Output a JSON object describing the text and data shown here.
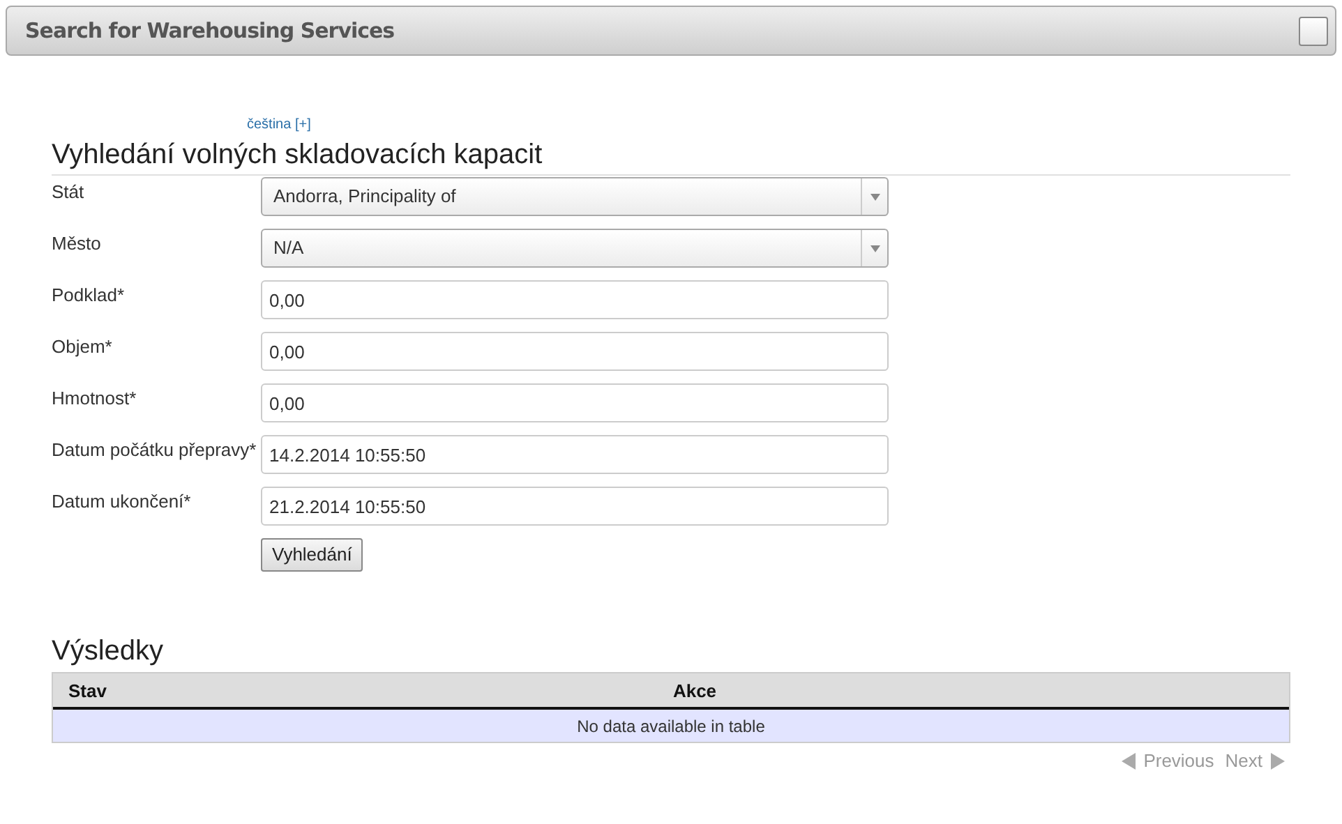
{
  "window": {
    "title": "Search for Warehousing Services",
    "checked": false
  },
  "language_link": "čeština [+]",
  "form": {
    "title": "Vyhledání volných skladovacích kapacit",
    "fields": [
      {
        "label": "Stát",
        "kind": "select",
        "value": "Andorra, Principality of"
      },
      {
        "label": "Město",
        "kind": "select",
        "value": "N/A"
      },
      {
        "label": "Podklad*",
        "kind": "text",
        "value": "0,00"
      },
      {
        "label": "Objem*",
        "kind": "text",
        "value": "0,00"
      },
      {
        "label": "Hmotnost*",
        "kind": "text",
        "value": "0,00"
      },
      {
        "label": "Datum počátku přepravy*",
        "kind": "text",
        "value": "14.2.2014 10:55:50"
      },
      {
        "label": "Datum ukončení*",
        "kind": "text",
        "value": "21.2.2014 10:55:50"
      }
    ],
    "submit": "Vyhledání"
  },
  "results": {
    "title": "Výsledky",
    "columns": [
      "Stav",
      "Akce"
    ],
    "empty_message": "No data available in table",
    "pagination": [
      {
        "label": "Previous",
        "kind": "prev",
        "disabled": true
      },
      {
        "label": "Next",
        "kind": "next",
        "disabled": true
      }
    ]
  }
}
